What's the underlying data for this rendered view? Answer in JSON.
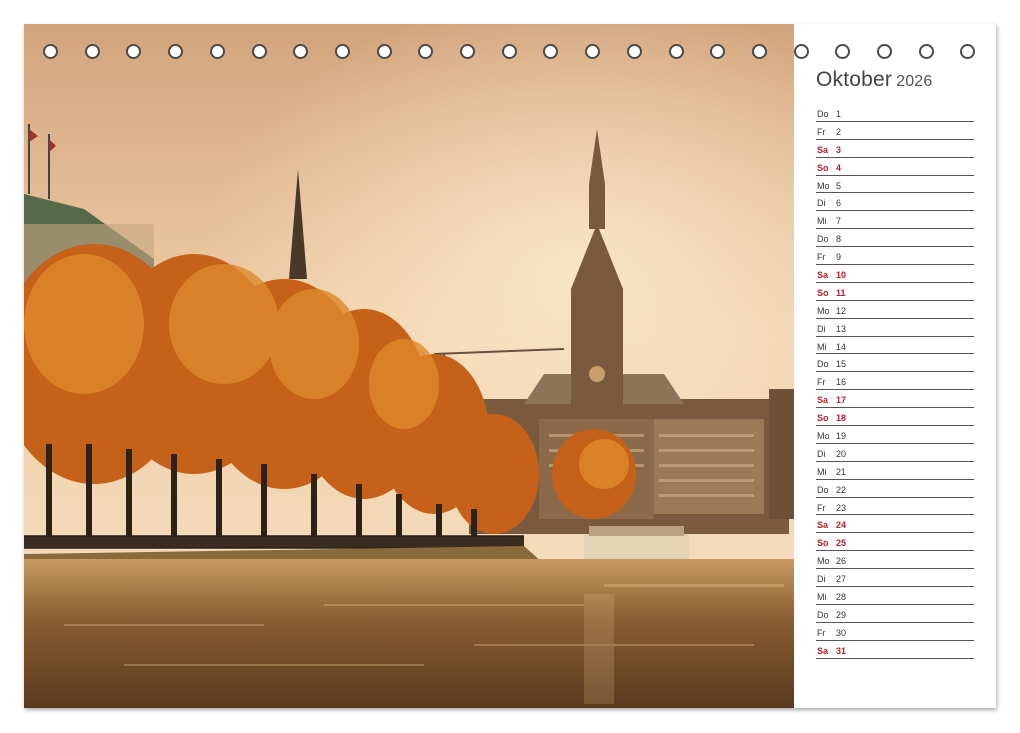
{
  "calendar": {
    "month": "Oktober",
    "year": "2026",
    "days": [
      {
        "dow": "Do",
        "day": "1",
        "weekend": false
      },
      {
        "dow": "Fr",
        "day": "2",
        "weekend": false
      },
      {
        "dow": "Sa",
        "day": "3",
        "weekend": true
      },
      {
        "dow": "So",
        "day": "4",
        "weekend": true
      },
      {
        "dow": "Mo",
        "day": "5",
        "weekend": false
      },
      {
        "dow": "Di",
        "day": "6",
        "weekend": false
      },
      {
        "dow": "Mi",
        "day": "7",
        "weekend": false
      },
      {
        "dow": "Do",
        "day": "8",
        "weekend": false
      },
      {
        "dow": "Fr",
        "day": "9",
        "weekend": false
      },
      {
        "dow": "Sa",
        "day": "10",
        "weekend": true
      },
      {
        "dow": "So",
        "day": "11",
        "weekend": true
      },
      {
        "dow": "Mo",
        "day": "12",
        "weekend": false
      },
      {
        "dow": "Di",
        "day": "13",
        "weekend": false
      },
      {
        "dow": "Mi",
        "day": "14",
        "weekend": false
      },
      {
        "dow": "Do",
        "day": "15",
        "weekend": false
      },
      {
        "dow": "Fr",
        "day": "16",
        "weekend": false
      },
      {
        "dow": "Sa",
        "day": "17",
        "weekend": true
      },
      {
        "dow": "So",
        "day": "18",
        "weekend": true
      },
      {
        "dow": "Mo",
        "day": "19",
        "weekend": false
      },
      {
        "dow": "Di",
        "day": "20",
        "weekend": false
      },
      {
        "dow": "Mi",
        "day": "21",
        "weekend": false
      },
      {
        "dow": "Do",
        "day": "22",
        "weekend": false
      },
      {
        "dow": "Fr",
        "day": "23",
        "weekend": false
      },
      {
        "dow": "Sa",
        "day": "24",
        "weekend": true
      },
      {
        "dow": "So",
        "day": "25",
        "weekend": true
      },
      {
        "dow": "Mo",
        "day": "26",
        "weekend": false
      },
      {
        "dow": "Di",
        "day": "27",
        "weekend": false
      },
      {
        "dow": "Mi",
        "day": "28",
        "weekend": false
      },
      {
        "dow": "Do",
        "day": "29",
        "weekend": false
      },
      {
        "dow": "Fr",
        "day": "30",
        "weekend": false
      },
      {
        "dow": "Sa",
        "day": "31",
        "weekend": true
      }
    ]
  },
  "binding": {
    "ring_count": 23
  },
  "colors": {
    "weekend": "#b3202a",
    "weekday": "#333333",
    "sky_top": "#d9b08a",
    "sky_bottom": "#f2d7b6",
    "foliage": "#c8641a",
    "water": "#6b4a2a"
  }
}
